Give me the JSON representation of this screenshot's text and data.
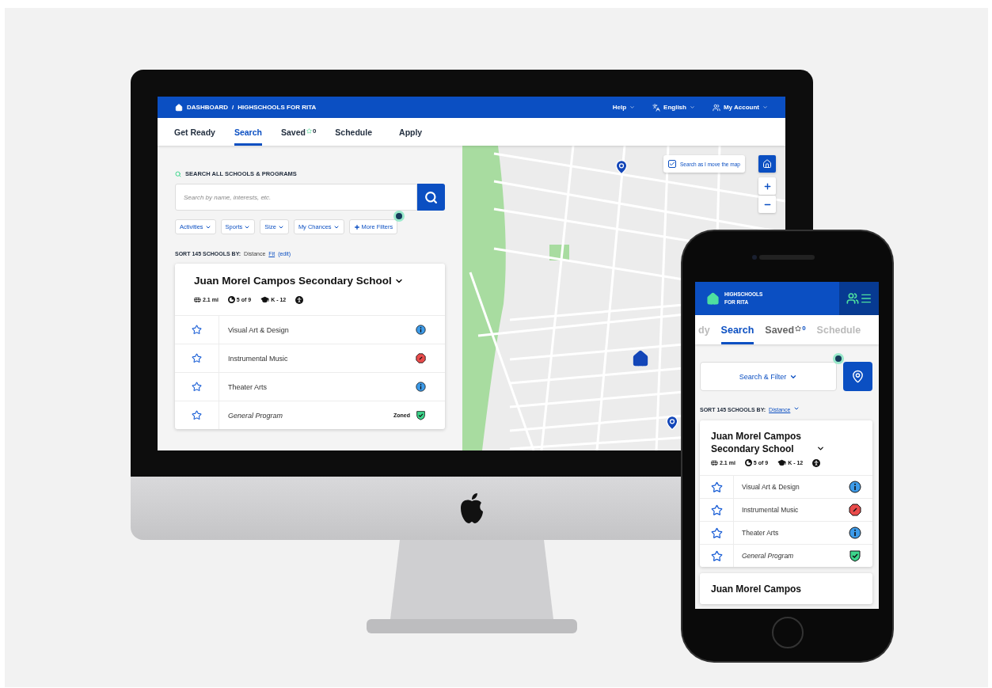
{
  "desktop": {
    "breadcrumb": [
      {
        "label": "DASHBOARD"
      },
      {
        "label": "HIGHSCHOOLS FOR RITA"
      }
    ],
    "breadcrumb_separator": "/",
    "top_links": [
      {
        "label": "Help",
        "kind": "plain"
      },
      {
        "label": "English",
        "kind": "translate"
      },
      {
        "label": "My Account",
        "kind": "account"
      }
    ],
    "tabs": [
      {
        "label": "Get Ready",
        "selected": false
      },
      {
        "label": "Search",
        "selected": true
      },
      {
        "label": "Saved",
        "selected": false,
        "count": "0"
      },
      {
        "label": "Schedule",
        "selected": false
      },
      {
        "label": "Apply",
        "selected": false
      }
    ],
    "search": {
      "heading": "SEARCH ALL SCHOOLS & PROGRAMS",
      "placeholder": "Search by name, interests, etc."
    },
    "filters": [
      {
        "label": "Activities",
        "kind": "dropdown"
      },
      {
        "label": "Sports",
        "kind": "dropdown"
      },
      {
        "label": "Size",
        "kind": "dropdown"
      },
      {
        "label": "My Chances",
        "kind": "dropdown"
      },
      {
        "label": "More Filters",
        "kind": "more"
      }
    ],
    "sort": {
      "label": "SORT 145 SCHOOLS BY:",
      "value": "Distance",
      "link": "Fit",
      "edit": "(edit)"
    },
    "school": {
      "name": "Juan Morel Campos Secondary School",
      "stats": [
        {
          "kind": "distance",
          "text": "2.1 mi"
        },
        {
          "kind": "chances",
          "text": "5 of 9"
        },
        {
          "kind": "grades",
          "text": "K - 12"
        },
        {
          "kind": "accessible"
        }
      ],
      "programs": [
        {
          "name": "Visual Art & Design",
          "kind": "info"
        },
        {
          "name": "Instrumental Music",
          "kind": "closed"
        },
        {
          "name": "Theater Arts",
          "kind": "info"
        },
        {
          "name": "General Program",
          "kind": "zoned",
          "badge": "Zoned"
        }
      ]
    },
    "map": {
      "checkbox": {
        "label": "Search as I move the map",
        "checked": true
      }
    }
  },
  "phone": {
    "title": "HIGHSCHOOLS FOR RITA",
    "tabs": [
      {
        "label": "dy",
        "selected": false
      },
      {
        "label": "Search",
        "selected": true
      },
      {
        "label": "Saved",
        "selected": false,
        "count": "0"
      },
      {
        "label": "Schedule",
        "selected": false
      }
    ],
    "filter_button": "Search & Filter",
    "sort": {
      "label": "SORT 145 SCHOOLS BY:",
      "value": "Distance"
    },
    "schools": [
      {
        "name": "Juan Morel Campos Secondary School",
        "stats": [
          {
            "kind": "distance",
            "text": "2.1 mi"
          },
          {
            "kind": "chances",
            "text": "5 of 9"
          },
          {
            "kind": "grades",
            "text": "K - 12"
          },
          {
            "kind": "accessible"
          }
        ],
        "programs": [
          {
            "name": "Visual Art & Design",
            "kind": "info"
          },
          {
            "name": "Instrumental Music",
            "kind": "closed"
          },
          {
            "name": "Theater Arts",
            "kind": "info"
          },
          {
            "name": "General Program",
            "kind": "zoned"
          }
        ]
      },
      {
        "name": "Juan Morel Campos"
      }
    ]
  }
}
